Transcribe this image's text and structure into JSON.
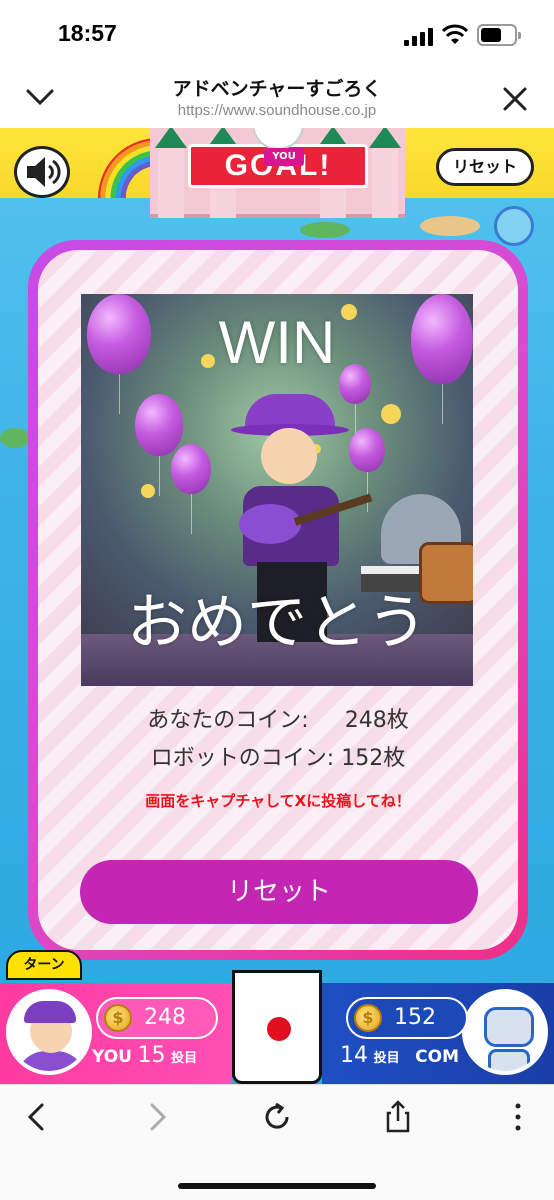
{
  "status_bar": {
    "time": "18:57"
  },
  "browser": {
    "title": "アドベンチャーすごろく",
    "url": "https://www.soundhouse.co.jp"
  },
  "game": {
    "goal_banner": "GOAL!",
    "you_tag": "YOU",
    "reset_top_label": "リセット",
    "modal": {
      "win_text": "WIN",
      "congrats_text": "おめでとう",
      "player_coins_label": "あなたのコイン:",
      "player_coins_value": "248枚",
      "robot_coins_label": "ロボットのコイン:",
      "robot_coins_value": "152枚",
      "capture_message": "画面をキャプチャしてXに投稿してね！",
      "reset_button": "リセット"
    },
    "turn_tab": "ターン",
    "player": {
      "coins": "248",
      "name": "YOU",
      "turn_count": "15",
      "turn_suffix": "投目"
    },
    "com": {
      "coins": "152",
      "name": "COM",
      "turn_count": "14",
      "turn_suffix": "投目"
    },
    "colors": {
      "modal_border": "#d94bcf",
      "reset_button": "#c426b4",
      "capture_message": "#e8141e",
      "player_bar": "#ff4fb4",
      "com_bar": "#1a3ea6"
    }
  },
  "toolbar": {
    "icons": [
      "back-icon",
      "forward-icon",
      "reload-icon",
      "share-icon",
      "more-icon"
    ]
  }
}
